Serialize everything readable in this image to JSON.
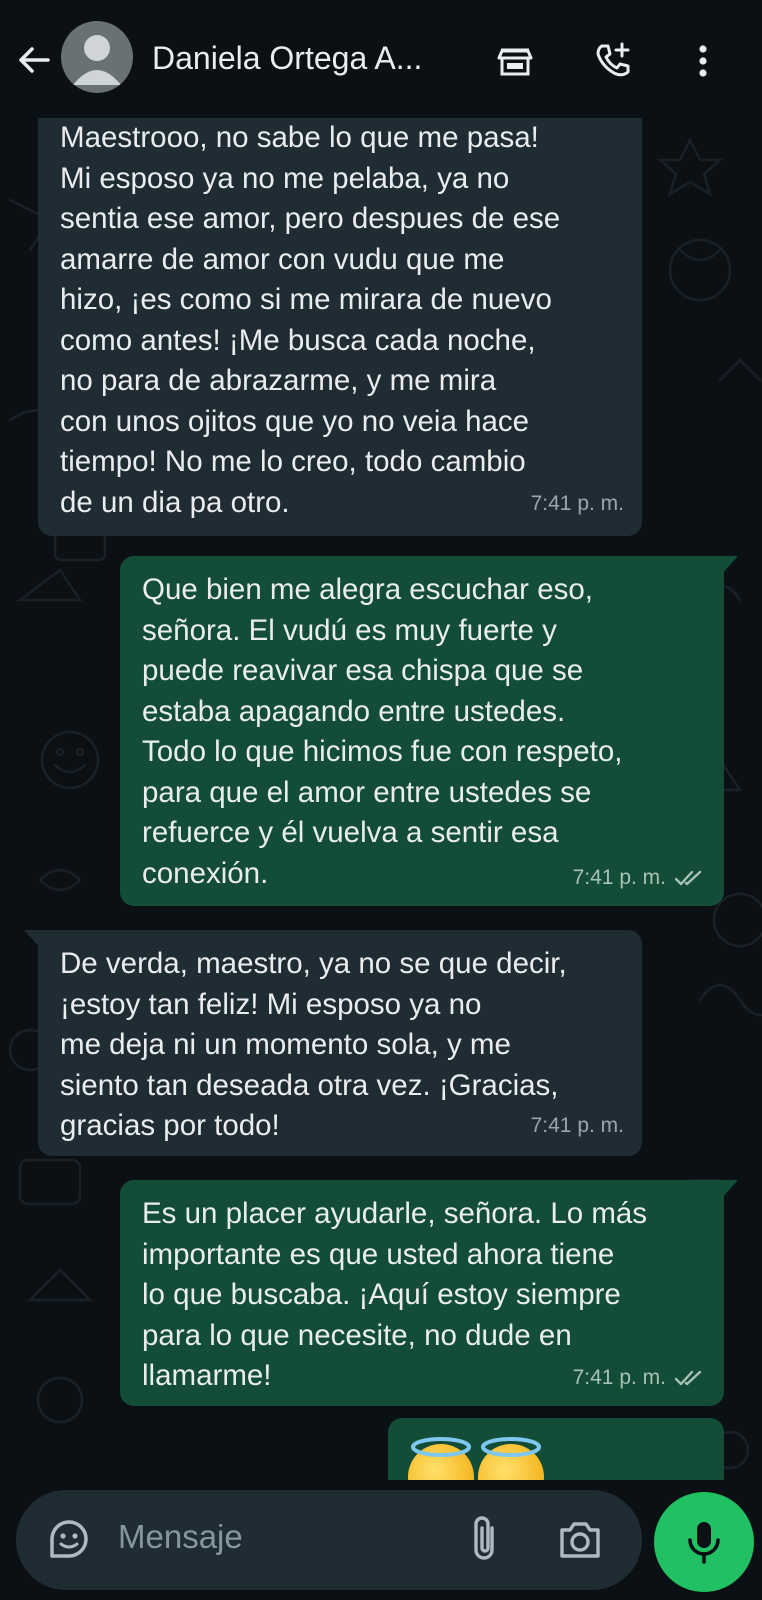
{
  "header": {
    "contact_name": "Daniela Ortega A...",
    "icons": [
      "back-arrow-icon",
      "avatar",
      "store-icon",
      "add-call-icon",
      "more-vertical-icon"
    ]
  },
  "messages": [
    {
      "direction": "incoming",
      "text": "Maestrooo, no sabe lo que me pasa!\nMi esposo ya no me pelaba, ya no\nsentia ese amor, pero despues de ese\namarre de amor con vudu que me\nhizo, ¡es como si me mirara de nuevo\ncomo antes! ¡Me busca cada noche,\nno para de abrazarme, y me mira\ncon unos ojitos que yo no veia hace\ntiempo! No me lo creo, todo cambio\nde un dia pa otro.",
      "time": "7:41 p. m."
    },
    {
      "direction": "outgoing",
      "text": "Que bien me alegra escuchar eso,\nseñora. El vudú es muy fuerte y\npuede reavivar esa chispa que se\nestaba apagando entre ustedes.\nTodo lo que hicimos fue con respeto,\npara que el amor entre ustedes se\nrefuerce y él vuelva a sentir esa\nconexión.",
      "time": "7:41 p. m.",
      "status": "read"
    },
    {
      "direction": "incoming",
      "text": "De verda, maestro, ya no se que decir,\n¡estoy tan feliz! Mi esposo ya no\nme deja ni un momento sola, y me\nsiento tan deseada otra vez. ¡Gracias,\ngracias por todo!",
      "time": "7:41 p. m."
    },
    {
      "direction": "outgoing",
      "text": "Es un placer ayudarle, señora. Lo más\nimportante es que usted ahora tiene\nlo que buscaba. ¡Aquí estoy siempre\npara lo que necesite, no dude en\nllamarme!",
      "time": "7:41 p. m.",
      "status": "read"
    },
    {
      "direction": "outgoing",
      "emoji": [
        "smiling-face-with-halo",
        "smiling-face-with-halo"
      ]
    }
  ],
  "input": {
    "placeholder": "Mensaje",
    "icons": [
      "sticker-icon",
      "attach-icon",
      "camera-icon",
      "mic-icon"
    ]
  },
  "colors": {
    "background": "#0b1014",
    "incoming_bubble": "#202c33",
    "outgoing_bubble": "#134d37",
    "mic_button": "#21c063"
  }
}
